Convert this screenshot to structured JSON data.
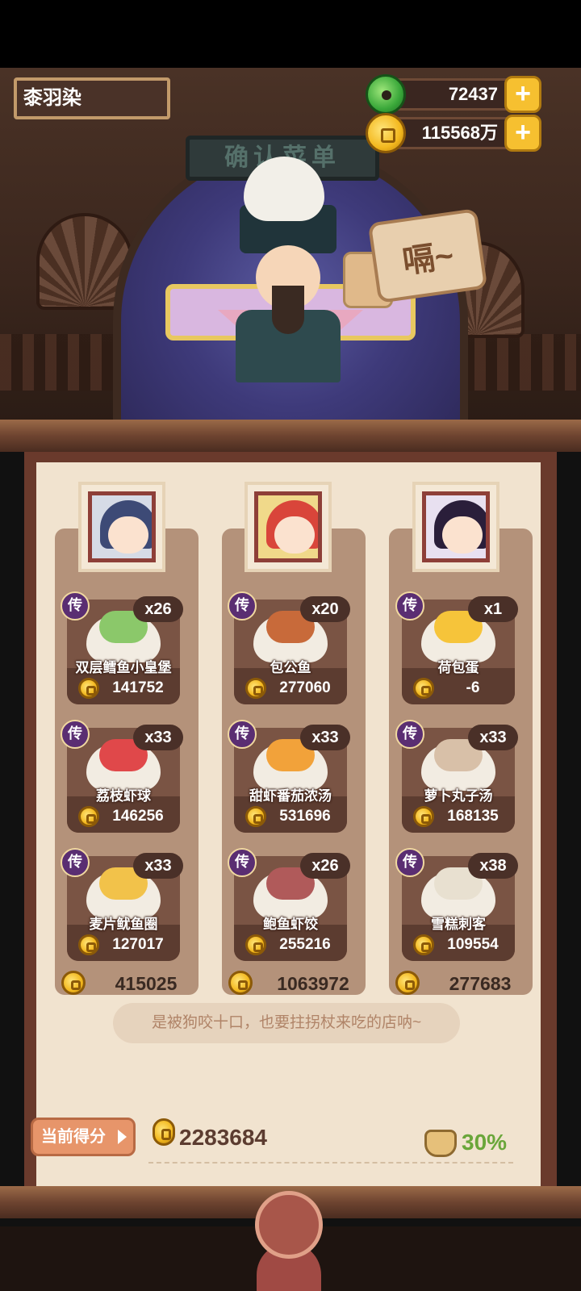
{
  "header": {
    "player_name": "桼羽染"
  },
  "currency": {
    "jade": "72437",
    "coins": "115568万"
  },
  "scene": {
    "sign_text": "确认菜单",
    "bubble_text": "嗝~"
  },
  "columns": [
    {
      "portrait_colors": {
        "hair": "#3d4a76",
        "bg": "#d6dbe6"
      },
      "dishes": [
        {
          "tier": "传",
          "count": "x26",
          "name": "双层鳕鱼小皇堡",
          "price": "141752",
          "food_color": "#8bc86a"
        },
        {
          "tier": "传",
          "count": "x33",
          "name": "荔枝虾球",
          "price": "146256",
          "food_color": "#e0484a"
        },
        {
          "tier": "传",
          "count": "x33",
          "name": "麦片鱿鱼圈",
          "price": "127017",
          "food_color": "#f2c24a"
        }
      ],
      "total": "415025"
    },
    {
      "portrait_colors": {
        "hair": "#d9453a",
        "bg": "#f0d98a"
      },
      "dishes": [
        {
          "tier": "传",
          "count": "x20",
          "name": "包公鱼",
          "price": "277060",
          "food_color": "#c86a3a"
        },
        {
          "tier": "传",
          "count": "x33",
          "name": "甜虾番茄浓汤",
          "price": "531696",
          "food_color": "#f2a23a"
        },
        {
          "tier": "传",
          "count": "x26",
          "name": "鲍鱼虾饺",
          "price": "255216",
          "food_color": "#b05a5a"
        }
      ],
      "total": "1063972"
    },
    {
      "portrait_colors": {
        "hair": "#2a1e3a",
        "bg": "#e8e0f0"
      },
      "dishes": [
        {
          "tier": "传",
          "count": "x1",
          "name": "荷包蛋",
          "price": "-6",
          "food_color": "#f6c43a"
        },
        {
          "tier": "传",
          "count": "x33",
          "name": "萝卜丸子汤",
          "price": "168135",
          "food_color": "#d8c0a8"
        },
        {
          "tier": "传",
          "count": "x38",
          "name": "雪糕刺客",
          "price": "109554",
          "food_color": "#e8e0d0"
        }
      ],
      "total": "277683"
    }
  ],
  "quote": "是被狗咬十口，也要拄拐杖来吃的店呐~",
  "score": {
    "label": "当前得分",
    "value": "2283684",
    "bonus": "30%"
  }
}
